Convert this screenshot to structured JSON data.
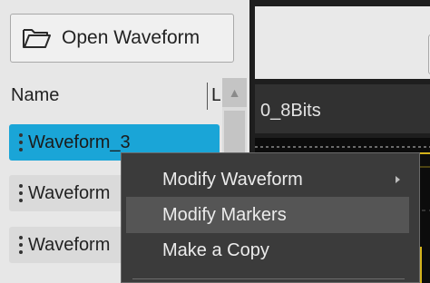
{
  "toolbar": {
    "open_waveform_label": "Open Waveform",
    "open_icon": "folder-open-icon"
  },
  "list": {
    "columns": [
      "Name",
      "L"
    ],
    "rows": [
      {
        "label": "Waveform_3",
        "selected": true
      },
      {
        "label": "Waveform",
        "selected": false
      },
      {
        "label": "Waveform",
        "selected": false
      }
    ],
    "scroll_up_icon": "triangle-up-icon"
  },
  "editor": {
    "waveform_title": "0_8Bits"
  },
  "context_menu": {
    "items": [
      {
        "label": "Modify Waveform",
        "has_submenu": true,
        "submenu_icon": "chevron-right-icon"
      },
      {
        "label": "Modify Markers",
        "hovered": true
      },
      {
        "label": "Make a Copy"
      }
    ]
  },
  "colors": {
    "selection": "#1aa5d7",
    "menu_background": "#3b3b3b",
    "menu_hover": "#555555",
    "panel_background": "#e7e7e7",
    "waveform_trace": "#d4b21b"
  }
}
